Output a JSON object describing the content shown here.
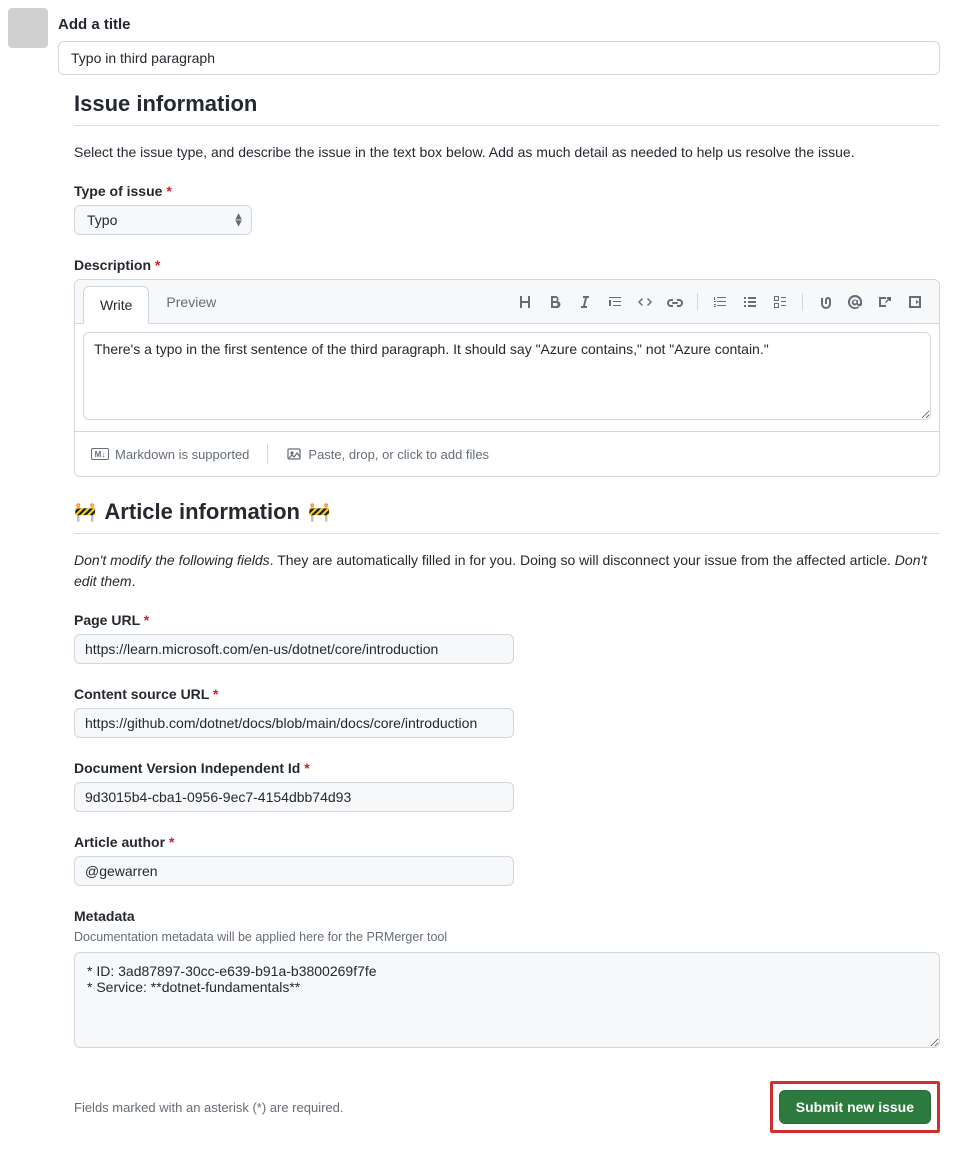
{
  "title": {
    "label": "Add a title",
    "value": "Typo in third paragraph"
  },
  "issue_info": {
    "heading": "Issue information",
    "description": "Select the issue type, and describe the issue in the text box below. Add as much detail as needed to help us resolve the issue.",
    "type_label": "Type of issue",
    "type_value": "Typo",
    "desc_label": "Description",
    "tabs": {
      "write": "Write",
      "preview": "Preview"
    },
    "desc_value": "There's a typo in the first sentence of the third paragraph. It should say \"Azure contains,\" not \"Azure contain.\"",
    "markdown_hint": "Markdown is supported",
    "attach_hint": "Paste, drop, or click to add files"
  },
  "article_info": {
    "heading": "Article information",
    "warn_prefix": "Don't modify the following fields",
    "warn_middle": ". They are automatically filled in for you. Doing so will disconnect your issue from the affected article. ",
    "warn_suffix": "Don't edit them",
    "warn_end": ".",
    "page_url_label": "Page URL",
    "page_url_value": "https://learn.microsoft.com/en-us/dotnet/core/introduction",
    "source_url_label": "Content source URL",
    "source_url_value": "https://github.com/dotnet/docs/blob/main/docs/core/introduction",
    "doc_version_label": "Document Version Independent Id",
    "doc_version_value": "9d3015b4-cba1-0956-9ec7-4154dbb74d93",
    "author_label": "Article author",
    "author_value": "@gewarren",
    "metadata_label": "Metadata",
    "metadata_helper": "Documentation metadata will be applied here for the PRMerger tool",
    "metadata_value": "* ID: 3ad87897-30cc-e639-b91a-b3800269f7fe\n* Service: **dotnet-fundamentals**"
  },
  "footer": {
    "required_text": "Fields marked with an asterisk (*) are required.",
    "submit_label": "Submit new issue"
  }
}
